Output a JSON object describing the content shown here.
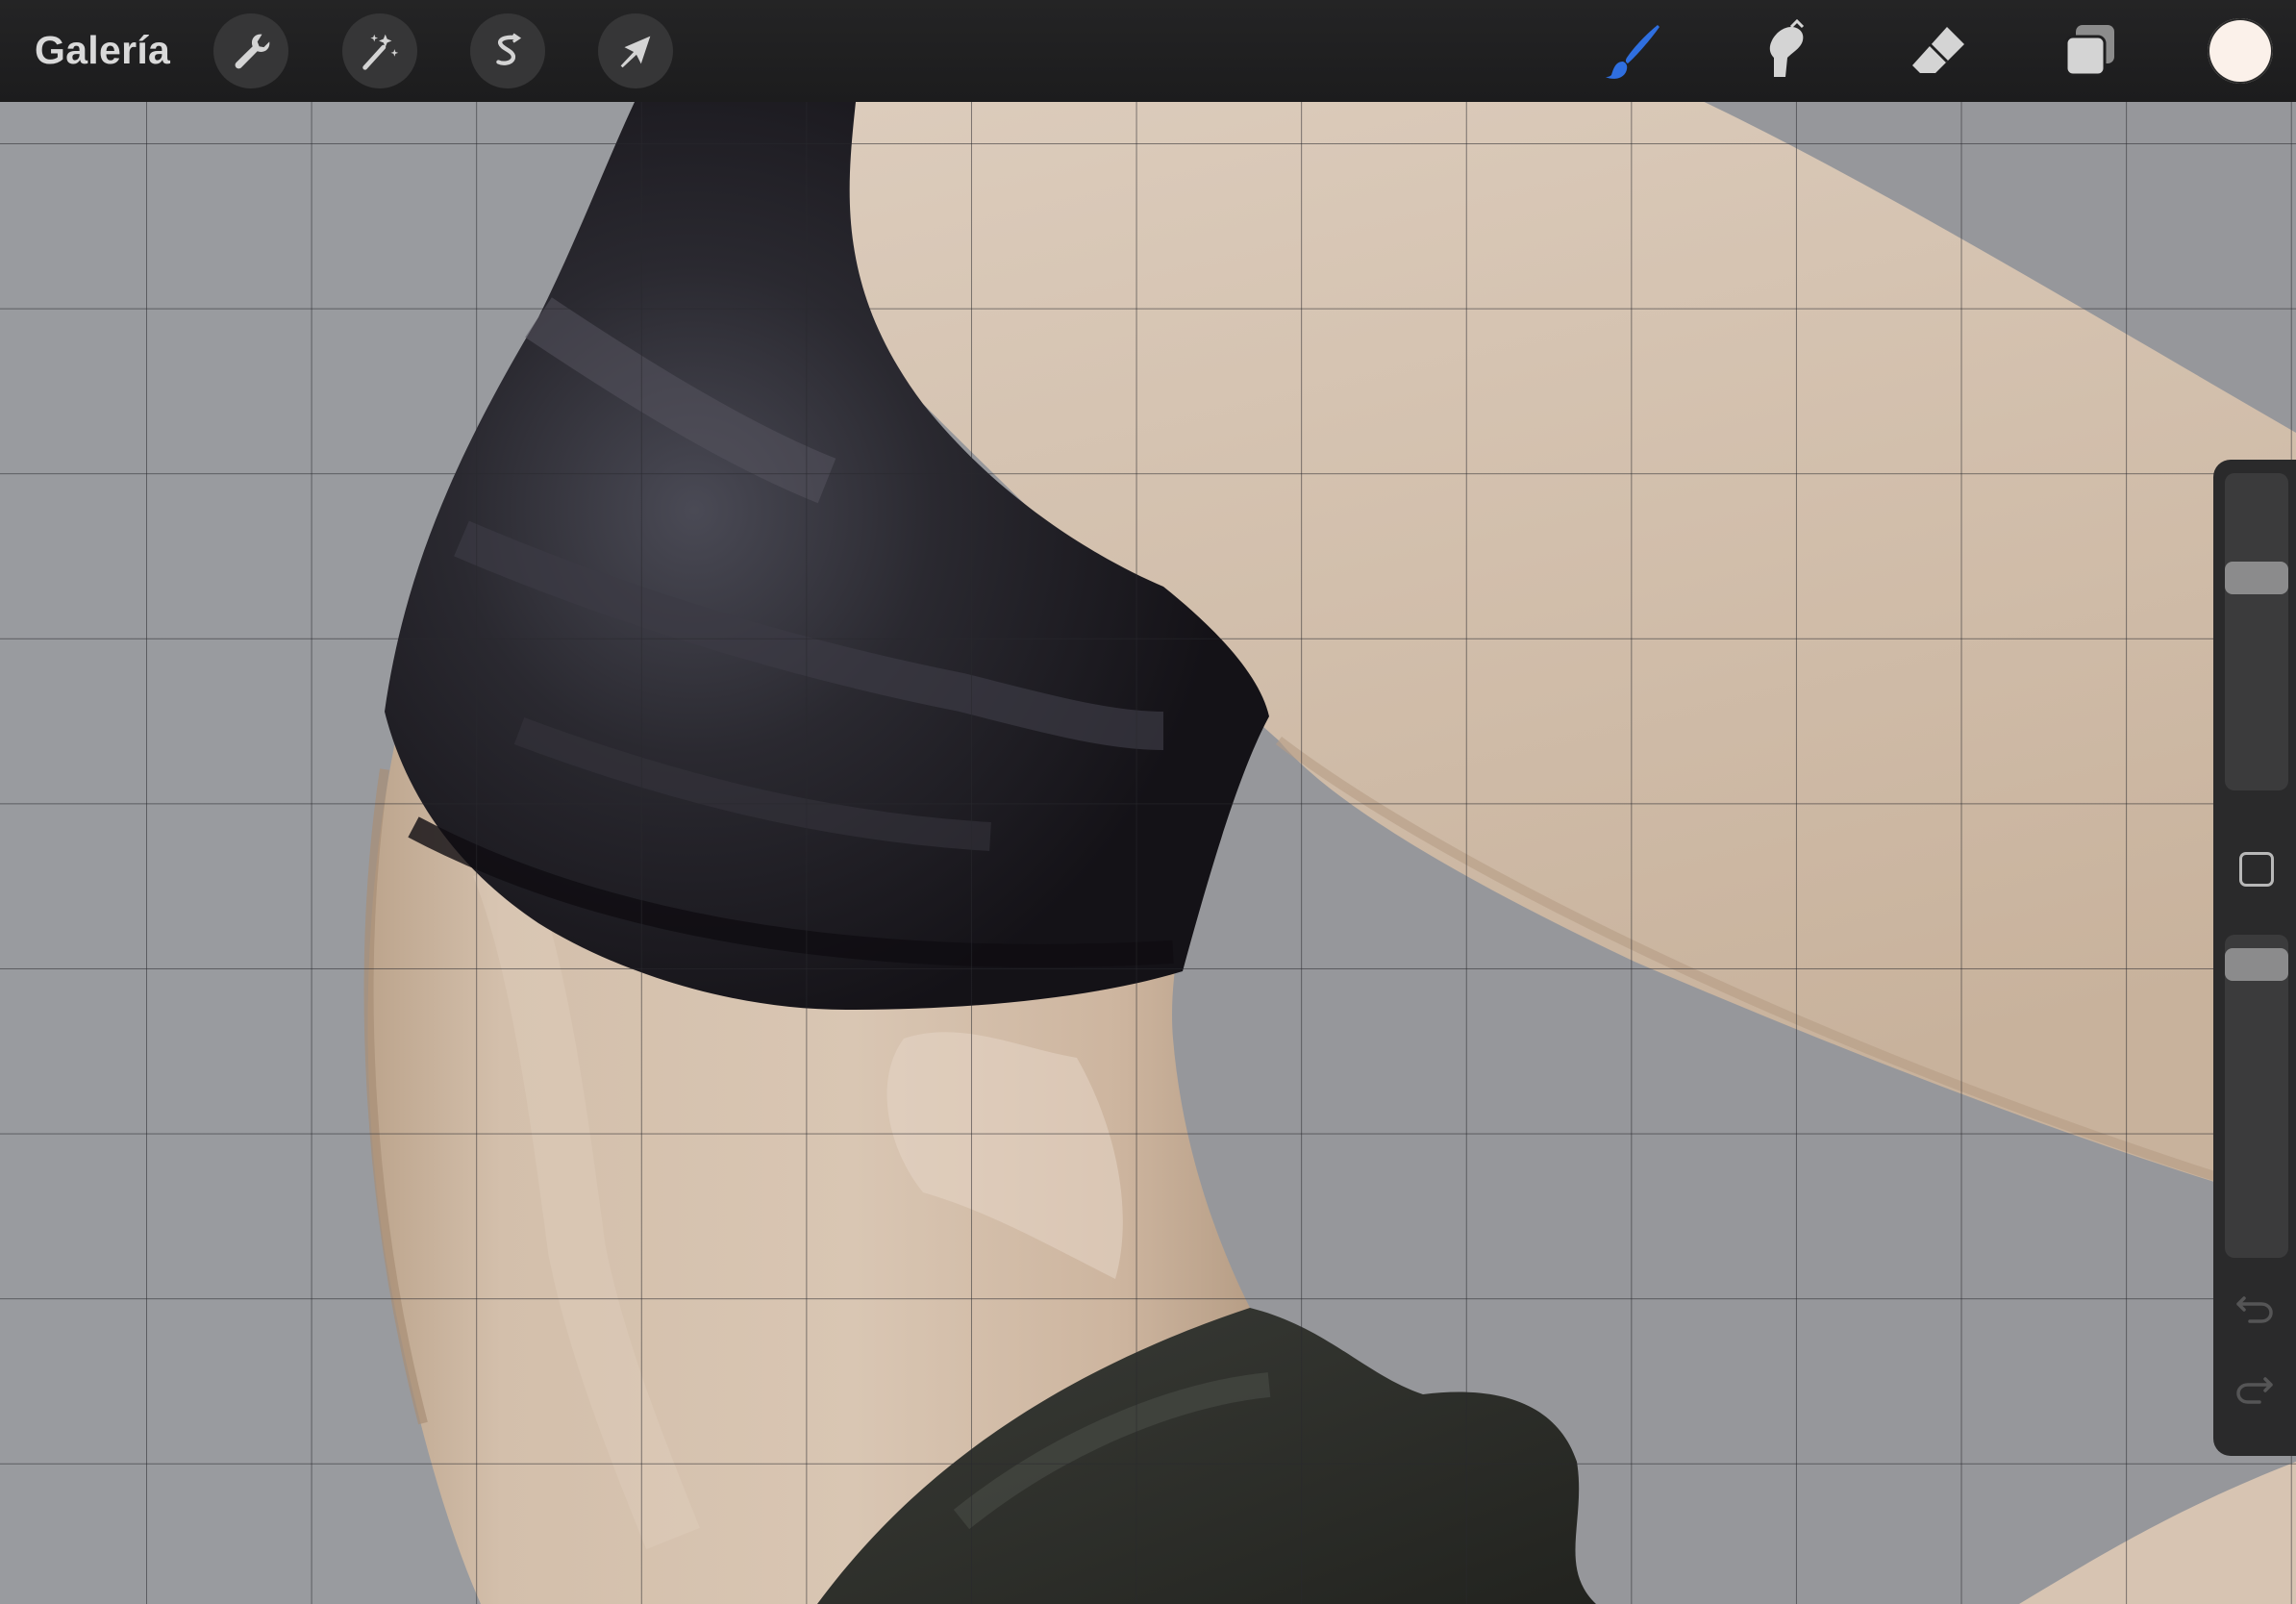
{
  "toolbar": {
    "gallery_label": "Galería",
    "left_tools": [
      {
        "name": "actions",
        "icon": "wrench-icon"
      },
      {
        "name": "adjustments",
        "icon": "magic-wand-icon"
      },
      {
        "name": "selection",
        "icon": "selection-s-icon"
      },
      {
        "name": "transform",
        "icon": "arrow-cursor-icon"
      }
    ],
    "right_tools": [
      {
        "name": "brush",
        "icon": "brush-icon",
        "active": true
      },
      {
        "name": "smudge",
        "icon": "smudge-finger-icon",
        "active": false
      },
      {
        "name": "eraser",
        "icon": "eraser-icon",
        "active": false
      },
      {
        "name": "layers",
        "icon": "layers-icon",
        "active": false
      }
    ],
    "current_color": "#fbf1ea"
  },
  "sidebar": {
    "brush_size_level": 0.3,
    "opacity_level": 0.02,
    "modify_button_icon": "square-icon",
    "undo_icon": "undo-arrow-icon",
    "redo_icon": "redo-arrow-icon"
  },
  "colors": {
    "accent_active_tool": "#2f6fe0",
    "toolbar_bg": "#1f1f20",
    "icon": "#d4d4d4",
    "background_gray": "#96979b",
    "skin": "#cbb39e",
    "top_fabric": "#1d1b20",
    "pants_fabric": "#2e302b"
  }
}
